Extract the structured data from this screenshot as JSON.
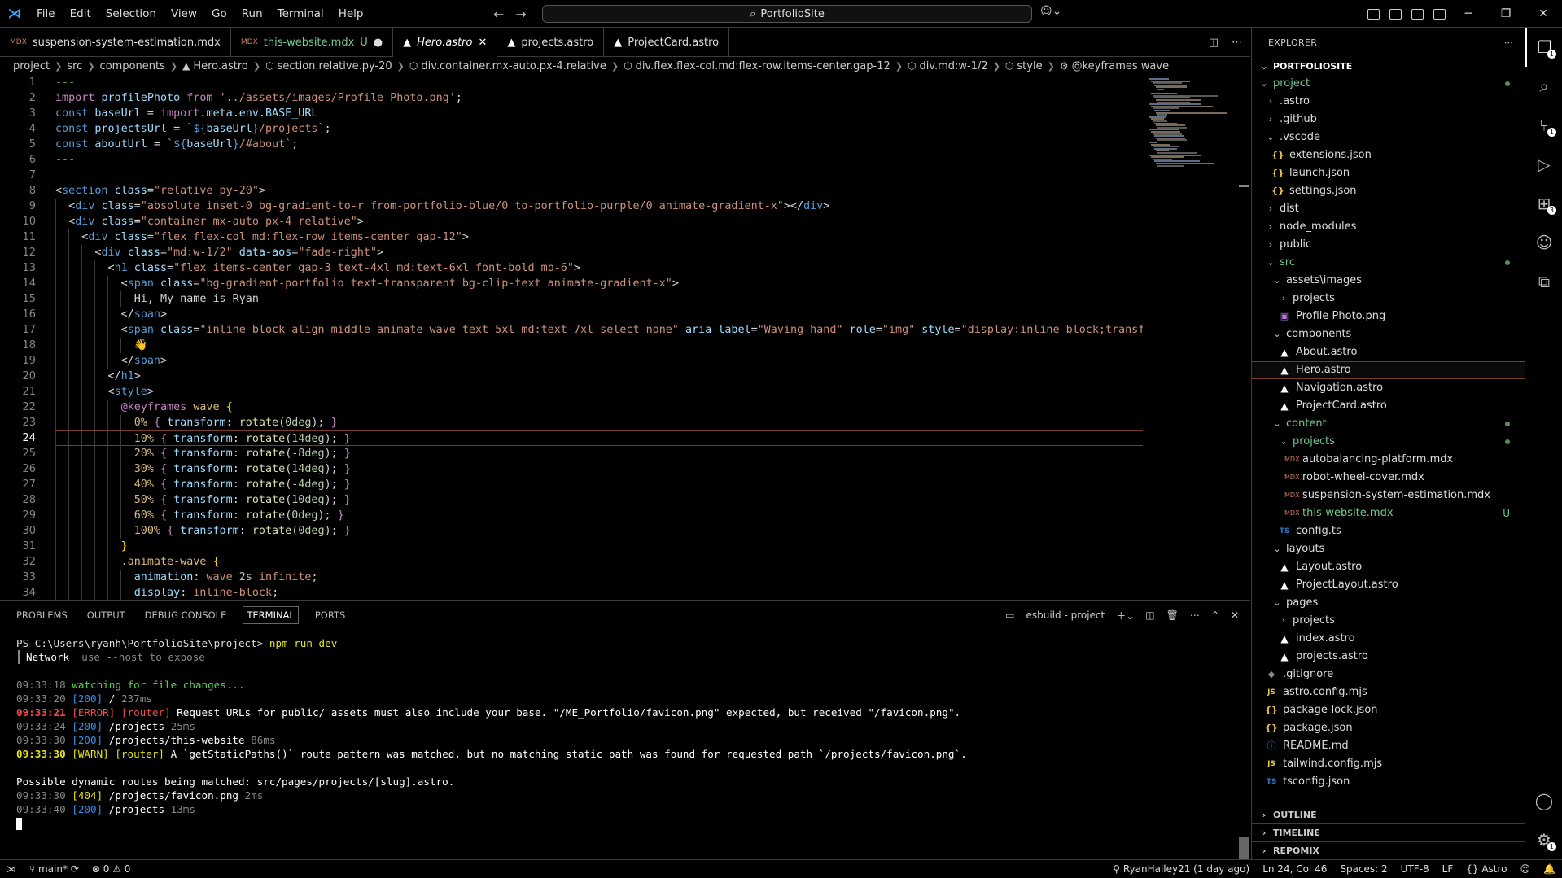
{
  "titlebar": {
    "menus": [
      "File",
      "Edit",
      "Selection",
      "View",
      "Go",
      "Run",
      "Terminal",
      "Help"
    ],
    "search": "PortfolioSite"
  },
  "tabs": [
    {
      "label": "suspension-system-estimation.mdx",
      "type": "mdx",
      "active": false,
      "status": ""
    },
    {
      "label": "this-website.mdx",
      "type": "mdx",
      "active": false,
      "status": "U"
    },
    {
      "label": "Hero.astro",
      "type": "astro",
      "active": true,
      "status": ""
    },
    {
      "label": "projects.astro",
      "type": "astro",
      "active": false,
      "status": ""
    },
    {
      "label": "ProjectCard.astro",
      "type": "astro",
      "active": false,
      "status": ""
    }
  ],
  "breadcrumb": [
    "project",
    "src",
    "components",
    "Hero.astro",
    "section.relative.py-20",
    "div.container.mx-auto.px-4.relative",
    "div.flex.flex-col.md:flex-row.items-center.gap-12",
    "div.md:w-1/2",
    "style",
    "@keyframes wave"
  ],
  "editor": {
    "current_line": 24,
    "line_numbers": [
      "1",
      "2",
      "3",
      "4",
      "5",
      "6",
      "7",
      "8",
      "9",
      "10",
      "11",
      "12",
      "13",
      "14",
      "15",
      "16",
      "17",
      "18",
      "19",
      "20",
      "21",
      "22",
      "23",
      "24",
      "25",
      "26",
      "27",
      "28",
      "29",
      "30",
      "31",
      "32",
      "33",
      "34"
    ]
  },
  "panel": {
    "tabs": [
      "PROBLEMS",
      "OUTPUT",
      "DEBUG CONSOLE",
      "TERMINAL",
      "PORTS"
    ],
    "active_tab": "TERMINAL",
    "terminal_name": "esbuild - project",
    "prompt": "PS C:\\Users\\ryanh\\PortfolioSite\\project>",
    "command": "npm run dev",
    "network_label": "Network",
    "network_hint": "use --host to expose",
    "log": [
      {
        "time": "09:33:18",
        "kind": "info",
        "text": "watching for file changes..."
      },
      {
        "time": "09:33:20",
        "kind": "ok",
        "status": "[200]",
        "path": "/",
        "ms": "237ms"
      },
      {
        "time": "09:33:21",
        "kind": "error",
        "tag": "[ERROR] [router]",
        "text": "Request URLs for public/ assets must also include your base. \"/ME_Portfolio/favicon.png\" expected, but received \"/favicon.png\"."
      },
      {
        "time": "09:33:24",
        "kind": "ok",
        "status": "[200]",
        "path": "/projects",
        "ms": "25ms"
      },
      {
        "time": "09:33:30",
        "kind": "ok",
        "status": "[200]",
        "path": "/projects/this-website",
        "ms": "86ms"
      },
      {
        "time": "09:33:30",
        "kind": "warn",
        "tag": "[WARN] [router]",
        "text": "A `getStaticPaths()` route pattern was matched, but no matching static path was found for requested path `/projects/favicon.png`."
      },
      {
        "kind": "blank"
      },
      {
        "kind": "plain",
        "text": "Possible dynamic routes being matched: src/pages/projects/[slug].astro."
      },
      {
        "time": "09:33:30",
        "kind": "notfound",
        "status": "[404]",
        "path": "/projects/favicon.png",
        "ms": "2ms"
      },
      {
        "time": "09:33:40",
        "kind": "ok",
        "status": "[200]",
        "path": "/projects",
        "ms": "13ms"
      }
    ]
  },
  "sidebar": {
    "header": "EXPLORER",
    "root": "PORTFOLIOSITE",
    "tree": [
      {
        "label": "project",
        "depth": 0,
        "type": "folder",
        "open": true,
        "dot": true,
        "git": true
      },
      {
        "label": ".astro",
        "depth": 1,
        "type": "folder",
        "open": false
      },
      {
        "label": ".github",
        "depth": 1,
        "type": "folder",
        "open": false
      },
      {
        "label": ".vscode",
        "depth": 1,
        "type": "folder",
        "open": true
      },
      {
        "label": "extensions.json",
        "depth": 2,
        "type": "json"
      },
      {
        "label": "launch.json",
        "depth": 2,
        "type": "json"
      },
      {
        "label": "settings.json",
        "depth": 2,
        "type": "json"
      },
      {
        "label": "dist",
        "depth": 1,
        "type": "folder",
        "open": false
      },
      {
        "label": "node_modules",
        "depth": 1,
        "type": "folder",
        "open": false
      },
      {
        "label": "public",
        "depth": 1,
        "type": "folder",
        "open": false
      },
      {
        "label": "src",
        "depth": 1,
        "type": "folder",
        "open": true,
        "dot": true,
        "git": true
      },
      {
        "label": "assets\\images",
        "depth": 2,
        "type": "folder",
        "open": true
      },
      {
        "label": "projects",
        "depth": 3,
        "type": "folder",
        "open": false
      },
      {
        "label": "Profile Photo.png",
        "depth": 3,
        "type": "img"
      },
      {
        "label": "components",
        "depth": 2,
        "type": "folder",
        "open": true
      },
      {
        "label": "About.astro",
        "depth": 3,
        "type": "astro"
      },
      {
        "label": "Hero.astro",
        "depth": 3,
        "type": "astro",
        "selected": true
      },
      {
        "label": "Navigation.astro",
        "depth": 3,
        "type": "astro"
      },
      {
        "label": "ProjectCard.astro",
        "depth": 3,
        "type": "astro"
      },
      {
        "label": "content",
        "depth": 2,
        "type": "folder",
        "open": true,
        "dot": true,
        "git": true
      },
      {
        "label": "projects",
        "depth": 3,
        "type": "folder",
        "open": true,
        "dot": true,
        "git": true
      },
      {
        "label": "autobalancing-platform.mdx",
        "depth": 4,
        "type": "mdx"
      },
      {
        "label": "robot-wheel-cover.mdx",
        "depth": 4,
        "type": "mdx"
      },
      {
        "label": "suspension-system-estimation.mdx",
        "depth": 4,
        "type": "mdx"
      },
      {
        "label": "this-website.mdx",
        "depth": 4,
        "type": "mdx",
        "badge": "U",
        "git": true
      },
      {
        "label": "config.ts",
        "depth": 3,
        "type": "ts"
      },
      {
        "label": "layouts",
        "depth": 2,
        "type": "folder",
        "open": true
      },
      {
        "label": "Layout.astro",
        "depth": 3,
        "type": "astro"
      },
      {
        "label": "ProjectLayout.astro",
        "depth": 3,
        "type": "astro"
      },
      {
        "label": "pages",
        "depth": 2,
        "type": "folder",
        "open": true
      },
      {
        "label": "projects",
        "depth": 3,
        "type": "folder",
        "open": false
      },
      {
        "label": "index.astro",
        "depth": 3,
        "type": "astro"
      },
      {
        "label": "projects.astro",
        "depth": 3,
        "type": "astro"
      },
      {
        "label": ".gitignore",
        "depth": 1,
        "type": "git"
      },
      {
        "label": "astro.config.mjs",
        "depth": 1,
        "type": "js"
      },
      {
        "label": "package-lock.json",
        "depth": 1,
        "type": "json"
      },
      {
        "label": "package.json",
        "depth": 1,
        "type": "json"
      },
      {
        "label": "README.md",
        "depth": 1,
        "type": "info"
      },
      {
        "label": "tailwind.config.mjs",
        "depth": 1,
        "type": "js"
      },
      {
        "label": "tsconfig.json",
        "depth": 1,
        "type": "ts"
      }
    ],
    "sections": [
      "OUTLINE",
      "TIMELINE",
      "REPOMIX"
    ]
  },
  "activity": {
    "explorer_badge": "1",
    "git_badge": "1",
    "extensions_badge": "3",
    "settings_badge": "1"
  },
  "statusbar": {
    "branch": "main*",
    "errors": "0",
    "warnings": "0",
    "blame": "RyanHailey21 (1 day ago)",
    "position": "Ln 24, Col 46",
    "spaces": "Spaces: 2",
    "encoding": "UTF-8",
    "eol": "LF",
    "language": "Astro"
  },
  "colors": {
    "accent": "#e8a95a",
    "git_untracked": "#73c991",
    "current_line_border": "#7a3b2e"
  }
}
